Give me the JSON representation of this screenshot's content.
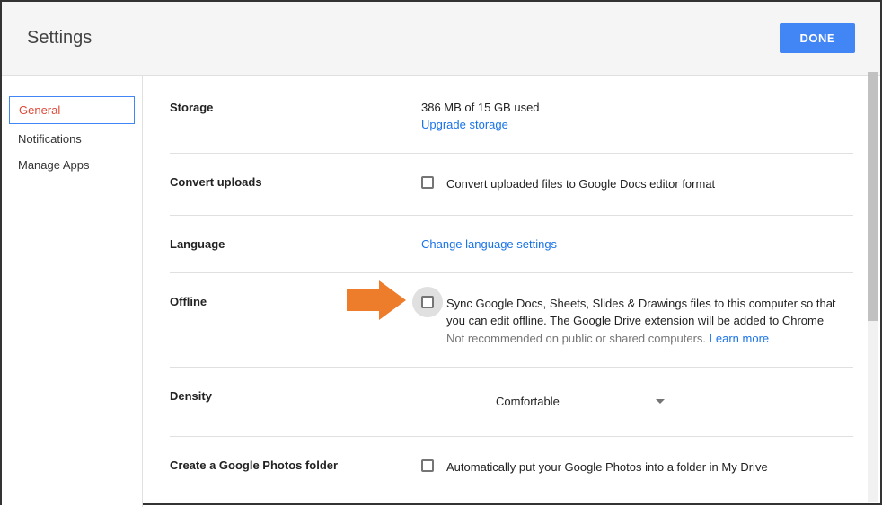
{
  "header": {
    "title": "Settings",
    "done_label": "DONE"
  },
  "sidebar": {
    "items": [
      {
        "label": "General",
        "active": true
      },
      {
        "label": "Notifications",
        "active": false
      },
      {
        "label": "Manage Apps",
        "active": false
      }
    ]
  },
  "settings": {
    "storage": {
      "label": "Storage",
      "used_text": "386 MB of 15 GB used",
      "upgrade_link": "Upgrade storage"
    },
    "convert": {
      "label": "Convert uploads",
      "checkbox_text": "Convert uploaded files to Google Docs editor format"
    },
    "language": {
      "label": "Language",
      "link_text": "Change language settings"
    },
    "offline": {
      "label": "Offline",
      "checkbox_text": "Sync Google Docs, Sheets, Slides & Drawings files to this computer so that you can edit offline. The Google Drive extension will be added to Chrome",
      "helper_text": "Not recommended on public or shared computers. ",
      "learn_more": "Learn more"
    },
    "density": {
      "label": "Density",
      "value": "Comfortable"
    },
    "photos": {
      "label": "Create a Google Photos folder",
      "checkbox_text": "Automatically put your Google Photos into a folder in My Drive"
    }
  }
}
